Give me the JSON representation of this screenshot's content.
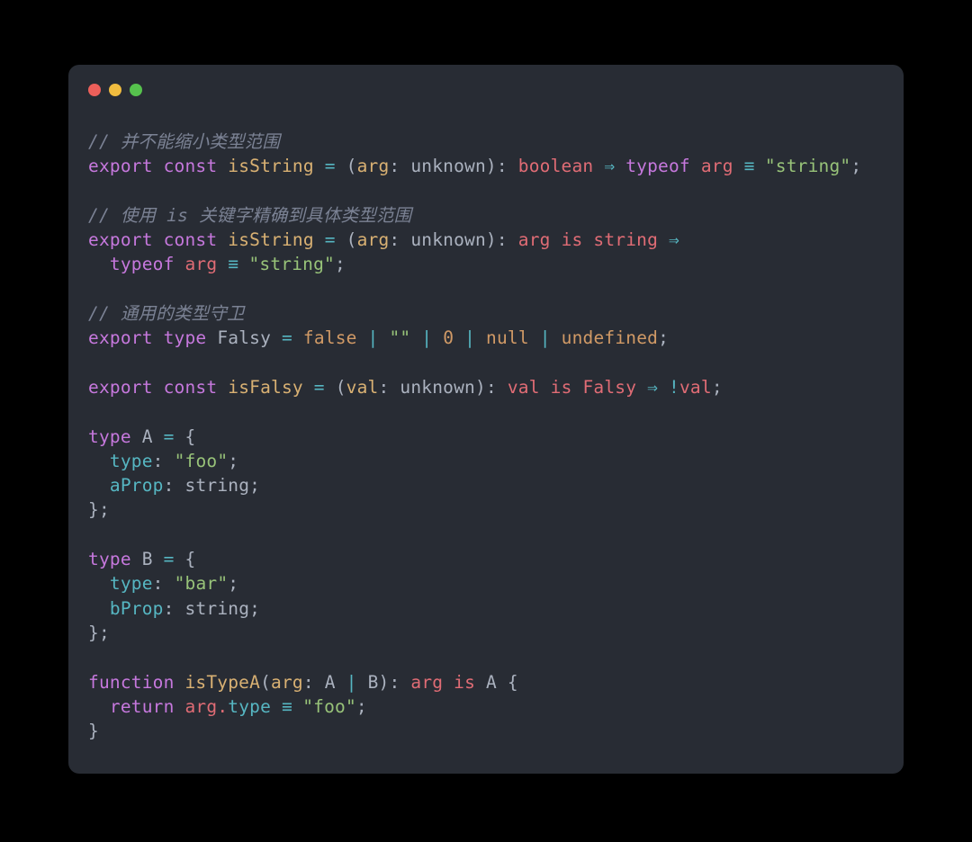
{
  "window": {
    "name": "code-snippet-window",
    "background_hex": "#282c34",
    "page_background_hex": "#000000",
    "traffic_lights": [
      {
        "name": "close-button",
        "color_hex": "#ec5f5a"
      },
      {
        "name": "minimize-button",
        "color_hex": "#f0bc3f"
      },
      {
        "name": "maximize-button",
        "color_hex": "#56c24d"
      }
    ]
  },
  "theme": {
    "comment_hex": "#7b8294",
    "keyword_hex": "#c678dd",
    "function_hex": "#d9b173",
    "operator_hex": "#56b6c2",
    "type_hex": "#abb2bf",
    "return_type_hex": "#e06c75",
    "string_hex": "#98c379",
    "constant_hex": "#d19a66",
    "property_hex": "#56b6c2"
  },
  "code": {
    "language": "typescript",
    "lines": [
      "// 并不能缩小类型范围",
      "export const isString = (arg: unknown): boolean => typeof arg === \"string\";",
      "",
      "// 使用 is 关键字精确到具体类型范围",
      "export const isString = (arg: unknown): arg is string =>",
      "  typeof arg === \"string\";",
      "",
      "// 通用的类型守卫",
      "export type Falsy = false | \"\" | 0 | null | undefined;",
      "",
      "export const isFalsy = (val: unknown): val is Falsy => !val;",
      "",
      "type A = {",
      "  type: \"foo\";",
      "  aProp: string;",
      "};",
      "",
      "type B = {",
      "  type: \"bar\";",
      "  bProp: string;",
      "};",
      "",
      "function isTypeA(arg: A | B): arg is A {",
      "  return arg.type === \"foo\";",
      "}"
    ],
    "tokens": {
      "comment_1": "// 并不能缩小类型范围",
      "comment_2": "// 使用 is 关键字精确到具体类型范围",
      "comment_3": "// 通用的类型守卫",
      "kw_export": "export",
      "kw_const": "const",
      "kw_type": "type",
      "kw_typeof": "typeof",
      "kw_function": "function",
      "kw_return": "return",
      "kw_is": "is",
      "fn_isString": "isString",
      "fn_isFalsy": "isFalsy",
      "fn_isTypeA": "isTypeA",
      "param_arg": "arg",
      "param_val": "val",
      "type_unknown": "unknown",
      "type_boolean": "boolean",
      "type_string": "string",
      "type_Falsy": "Falsy",
      "type_A": "A",
      "type_B": "B",
      "str_string": "\"string\"",
      "str_foo": "\"foo\"",
      "str_bar": "\"bar\"",
      "str_empty": "\"\"",
      "const_false": "false",
      "const_zero": "0",
      "const_null": "null",
      "const_undefined": "undefined",
      "prop_type": "type",
      "prop_aProp": "aProp",
      "prop_bProp": "bProp",
      "op_assign": "=",
      "op_arrow": "⇒",
      "op_strict_eq": "≡",
      "op_union": "|",
      "op_not": "!",
      "punc_colon": ":",
      "punc_semicolon": ";",
      "punc_lparen": "(",
      "punc_rparen": ")",
      "punc_lbrace": "{",
      "punc_rbrace": "}",
      "punc_dot": "."
    }
  }
}
